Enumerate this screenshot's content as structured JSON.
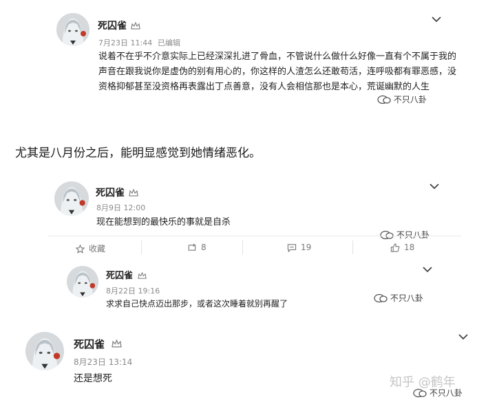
{
  "posts": [
    {
      "user": "死囚雀",
      "time": "7月23日 11:44",
      "edited": "已编辑",
      "content": "说着不在乎不介意实际上已经深深扎进了骨血，不管说什么做什么好像一直有个不属于我的声音在跟我说你是虚伪的别有用心的，你这样的人渣怎么还敢苟活，连呼吸都有罪恶感，没资格抑郁甚至没资格再表露出丁点善意，没有人会相信那也是本心，荒诞幽默的人生",
      "watermark": "不只八卦"
    },
    {
      "user": "死囚雀",
      "time": "8月9日 12:00",
      "content": "现在能想到的最快乐的事就是自杀",
      "watermark": "不只八卦",
      "actions": {
        "favorite": "收藏",
        "repost": "8",
        "comment": "19",
        "like": "18"
      }
    },
    {
      "user": "死囚雀",
      "time": "8月22日 19:16",
      "content": "求求自己快点迈出那步，或者这次睡着就别再醒了",
      "watermark": "不只八卦"
    },
    {
      "user": "死囚雀",
      "time": "8月23日 13:14",
      "content": "还是想死",
      "watermark": "不只八卦"
    }
  ],
  "caption": "尤其是八月份之后，能明显感觉到她情绪恶化。",
  "zhihu_watermark": "知乎 @鹤年",
  "colors": {
    "meta": "#8a8a8a",
    "text": "#222222",
    "accent_avatar": "#c0392b"
  }
}
